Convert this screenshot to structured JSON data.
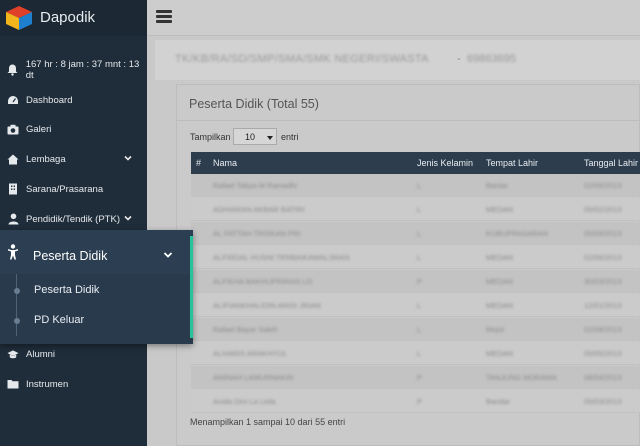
{
  "app": {
    "title": "Dapodik"
  },
  "sidebar": {
    "timer": "167 hr : 8 jam : 37 mnt : 13 dt",
    "items": [
      {
        "label": "Dashboard"
      },
      {
        "label": "Galeri"
      },
      {
        "label": "Lembaga"
      },
      {
        "label": "Sarana/Prasarana"
      },
      {
        "label": "Pendidik/Tendik (PTK)"
      },
      {
        "label": "Alumni"
      },
      {
        "label": "Instrumen"
      }
    ],
    "popup": {
      "title": "Peserta Didik",
      "subitems": [
        {
          "label": "Peserta Didik"
        },
        {
          "label": "PD Keluar"
        }
      ]
    }
  },
  "school": {
    "name": "TK/KB/RA/SD/SMP/SMA/SMK NEGERI/SWASTA",
    "separator": "-",
    "npsn": "69863695"
  },
  "card": {
    "title": "Peserta Didik (Total 55)",
    "show_label": "Tampilkan",
    "show_value": "10",
    "show_after": "entri",
    "footer": "Menampilkan 1 sampai 10 dari 55 entri"
  },
  "table": {
    "headers": [
      "#",
      "Nama",
      "Jenis Kelamin",
      "Tempat Lahir",
      "Tanggal Lahir"
    ],
    "rows": [
      [
        "Rafael Tabya M Ramadhi",
        "L",
        "Bantar",
        "02/05/2013"
      ],
      [
        "ADHIARAN AKBAR BATIRI",
        "L",
        "MEDAN",
        "05/02/2013"
      ],
      [
        "AL FATTAH TRISKAN PRI",
        "L",
        "KUBUPRASARAN",
        "05/09/2013"
      ],
      [
        "ALFIRDAL HUSNI TERBAIKAWALSRAN",
        "L",
        "MEDAN",
        "02/06/2013"
      ],
      [
        "ALFIKHA BAKHUPRIRAN LO",
        "P",
        "MEDAN",
        "30/03/2013"
      ],
      [
        "ALIFIANKHALIDIN ARISI JRIAN",
        "L",
        "MEDAN",
        "12/01/2013"
      ],
      [
        "Rafael Bayar Saleh",
        "L",
        "Mojol",
        "02/08/2013"
      ],
      [
        "ALHARIS ARAKHYUL",
        "L",
        "MEDAN",
        "05/05/2013"
      ],
      [
        "AMINAH LAMURNAKIN",
        "P",
        "TANJUNG MORAWA",
        "08/04/2013"
      ],
      [
        "Anida Dini La Leila",
        "P",
        "Bandar",
        "05/03/2013"
      ]
    ]
  },
  "colors": {
    "sidebar": "#1f2d3a",
    "accent": "#27c49a",
    "table_header": "#2d3d4e",
    "overlay": "#c9c9c9"
  }
}
